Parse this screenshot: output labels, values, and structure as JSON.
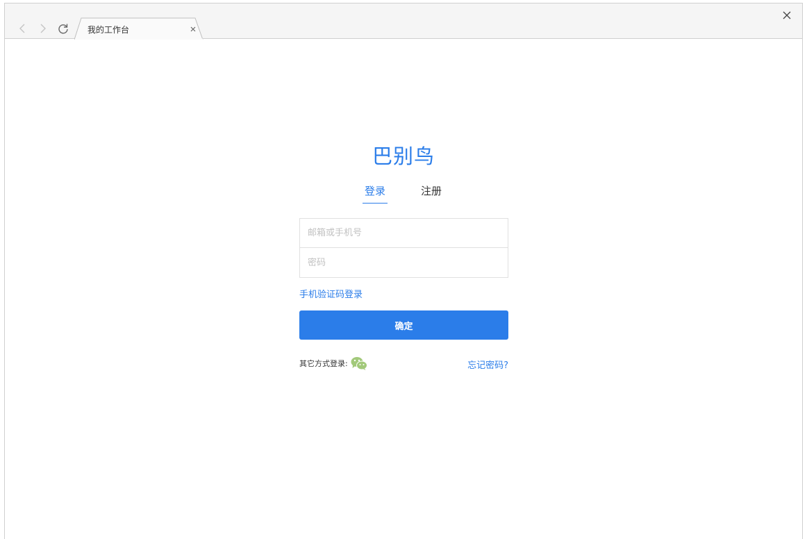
{
  "browser": {
    "tab_title": "我的工作台"
  },
  "login": {
    "brand": "巴别鸟",
    "tabs": [
      {
        "label": "登录",
        "active": true
      },
      {
        "label": "注册",
        "active": false
      }
    ],
    "account_placeholder": "邮箱或手机号",
    "password_placeholder": "密码",
    "sms_login_label": "手机验证码登录",
    "submit_label": "确定",
    "other_methods_label": "其它方式登录:",
    "other_methods_icon": "wechat-icon",
    "forgot_password_label": "忘记密码?"
  },
  "colors": {
    "accent": "#2b7de9",
    "wechat": "#a2c97a"
  }
}
